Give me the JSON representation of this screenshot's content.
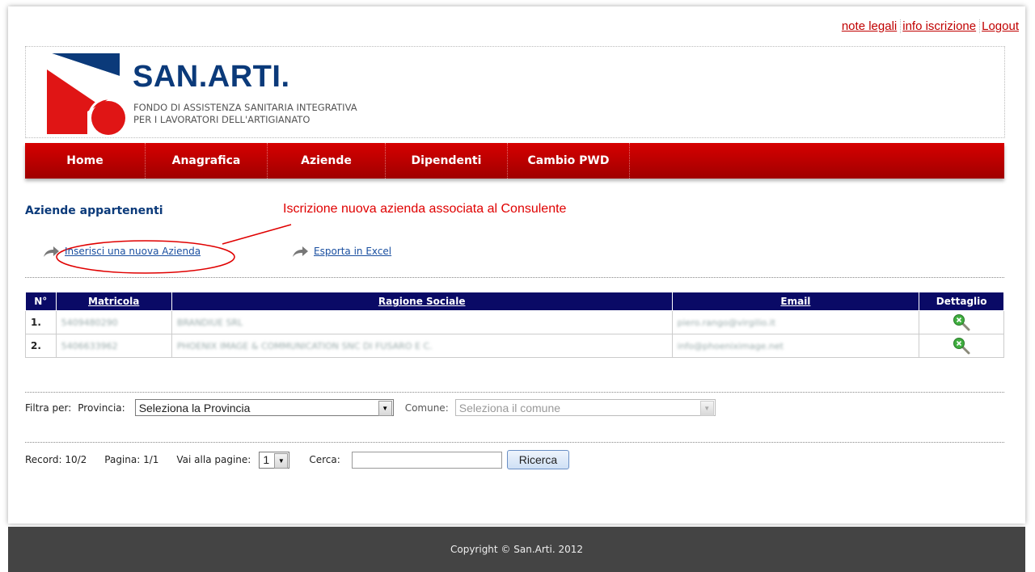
{
  "toplinks": {
    "note": "note legali",
    "info": "info iscrizione",
    "logout": "Logout"
  },
  "logo": {
    "title": "SAN.ARTI.",
    "subtitle_line1": "FONDO DI ASSISTENZA SANITARIA INTEGRATIVA",
    "subtitle_line2": "PER I LAVORATORI DELL'ARTIGIANATO"
  },
  "nav": {
    "items": [
      {
        "label": "Home"
      },
      {
        "label": "Anagrafica"
      },
      {
        "label": "Aziende"
      },
      {
        "label": "Dipendenti"
      },
      {
        "label": "Cambio PWD"
      }
    ]
  },
  "section": {
    "title": "Aziende appartenenti"
  },
  "annotation": {
    "text": "Iscrizione nuova azienda associata al Consulente"
  },
  "actions": {
    "insert": "Inserisci una nuova Azienda",
    "export": "Esporta in Excel"
  },
  "table": {
    "headers": {
      "n": "N°",
      "matricola": "Matricola",
      "ragione": "Ragione Sociale",
      "email": "Email",
      "dettaglio": "Dettaglio"
    },
    "rows": [
      {
        "n": "1.",
        "matricola": "5409480290",
        "ragione": "BRANDIUE SRL",
        "email": "piero.rango@virgilio.it"
      },
      {
        "n": "2.",
        "matricola": "5406633962",
        "ragione": "PHOENIX IMAGE & COMMUNICATION SNC DI FUSARO E C.",
        "email": "info@phoeniximage.net"
      }
    ]
  },
  "filters": {
    "label": "Filtra per:",
    "provincia_label": "Provincia:",
    "provincia_value": "Seleziona la Provincia",
    "comune_label": "Comune:",
    "comune_value": "Seleziona il comune"
  },
  "pager": {
    "record": "Record: 10/2",
    "pagina": "Pagina: 1/1",
    "vai_label": "Vai alla pagine:",
    "page_value": "1",
    "cerca_label": "Cerca:",
    "search_button": "Ricerca"
  },
  "footer": {
    "copyright": "Copyright © San.Arti. 2012"
  },
  "colors": {
    "brand_red": "#c00000",
    "brand_blue": "#0b3a7a",
    "table_header": "#0a0a66",
    "annotation": "#e00000"
  }
}
